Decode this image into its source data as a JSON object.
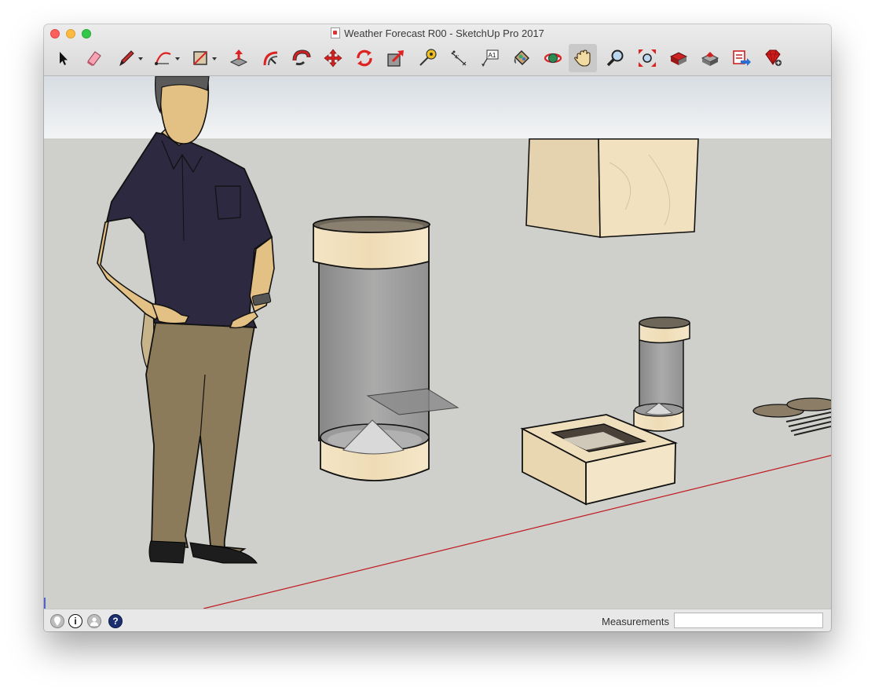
{
  "window": {
    "title": "Weather Forecast R00 - SketchUp Pro 2017"
  },
  "toolbar": {
    "tools": [
      {
        "name": "select-tool"
      },
      {
        "name": "eraser-tool"
      },
      {
        "name": "line-tool"
      },
      {
        "name": "arc-tool"
      },
      {
        "name": "shape-tool"
      },
      {
        "name": "push-pull-tool"
      },
      {
        "name": "offset-tool"
      },
      {
        "name": "follow-me-tool"
      },
      {
        "name": "move-tool"
      },
      {
        "name": "rotate-tool"
      },
      {
        "name": "scale-tool"
      },
      {
        "name": "tape-measure-tool"
      },
      {
        "name": "dimension-tool"
      },
      {
        "name": "text-tool",
        "glyph": "A1"
      },
      {
        "name": "paint-bucket-tool"
      },
      {
        "name": "orbit-tool"
      },
      {
        "name": "pan-tool",
        "active": true
      },
      {
        "name": "zoom-tool"
      },
      {
        "name": "zoom-extents-tool"
      },
      {
        "name": "3d-warehouse-tool"
      },
      {
        "name": "extension-warehouse-tool"
      },
      {
        "name": "layout-tool"
      },
      {
        "name": "extension-manager-tool"
      }
    ]
  },
  "statusbar": {
    "icons": [
      "geolocation-icon",
      "credits-icon",
      "user-icon",
      "help-icon"
    ],
    "help_glyph": "?",
    "credits_glyph": "i",
    "measurements_label": "Measurements",
    "measurements_value": ""
  },
  "colors": {
    "sky_top": "#dde2e6",
    "ground": "#cfcfcc",
    "plywood": "#efdfbd",
    "glass": "#8d8d8d",
    "shirt": "#2c2940",
    "pants": "#8b7b5a",
    "skin": "#e3c083",
    "red_axis": "#c0191e"
  }
}
